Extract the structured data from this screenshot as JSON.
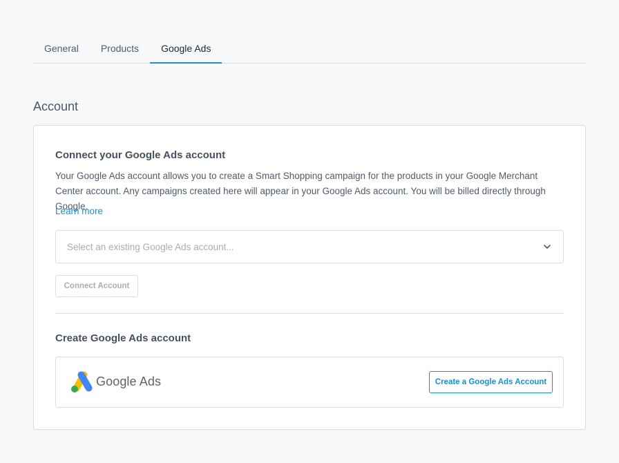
{
  "tabs": [
    {
      "label": "General",
      "active": false
    },
    {
      "label": "Products",
      "active": false
    },
    {
      "label": "Google Ads",
      "active": true
    }
  ],
  "section": {
    "title": "Account"
  },
  "connect": {
    "heading": "Connect your Google Ads account",
    "description": "Your Google Ads account allows you to create a Smart Shopping campaign for the products in your Google Merchant Center account. Any campaigns created here will appear in your Google Ads account. You will be billed directly through Google.",
    "learn_more": "Learn more",
    "select_placeholder": "Select an existing Google Ads account...",
    "connect_button": "Connect Account"
  },
  "create": {
    "heading": "Create Google Ads account",
    "logo_text": "Google Ads",
    "create_button": "Create a Google Ads Account"
  },
  "colors": {
    "accent": "#1a90d4",
    "border": "#d8dde3",
    "background": "#f7f8fa"
  },
  "icons": {
    "select": "chevron-down-icon",
    "logo": "google-ads-logo-icon"
  }
}
